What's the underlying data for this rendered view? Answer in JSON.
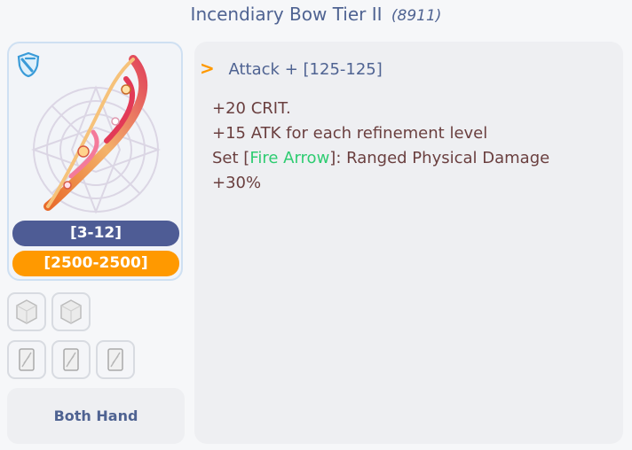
{
  "header": {
    "title": "Incendiary Bow Tier II",
    "item_id": "(8911)"
  },
  "item_card": {
    "icon": "bow-icon",
    "badge_icon": "shield-icon",
    "range_label": "[3-12]",
    "durability_label": "[2500-2500]",
    "colors": {
      "range_pill": "#4e5c95",
      "durability_pill": "#ff9900",
      "border": "#cfe0f2"
    }
  },
  "slots": {
    "gem_slots": [
      {
        "icon": "gem-slot-icon"
      },
      {
        "icon": "gem-slot-icon"
      }
    ],
    "card_slots": [
      {
        "icon": "card-slot-icon"
      },
      {
        "icon": "card-slot-icon"
      },
      {
        "icon": "card-slot-icon"
      }
    ]
  },
  "hand": {
    "label": "Both Hand"
  },
  "details": {
    "attack_chevron": ">",
    "attack_label": "Attack",
    "attack_plus": "+",
    "attack_value": "[125-125]",
    "effects": {
      "line1": "+20 CRIT.",
      "line2": "+15 ATK for each refinement level",
      "line3_prefix": "Set [",
      "line3_highlight": "Fire Arrow",
      "line3_suffix": "]: Ranged Physical Damage",
      "line4": "+30%"
    },
    "colors": {
      "accent": "#ff9900",
      "highlight": "#2ecc71",
      "effect_text": "#6a3f3f",
      "label": "#4f6392"
    }
  }
}
